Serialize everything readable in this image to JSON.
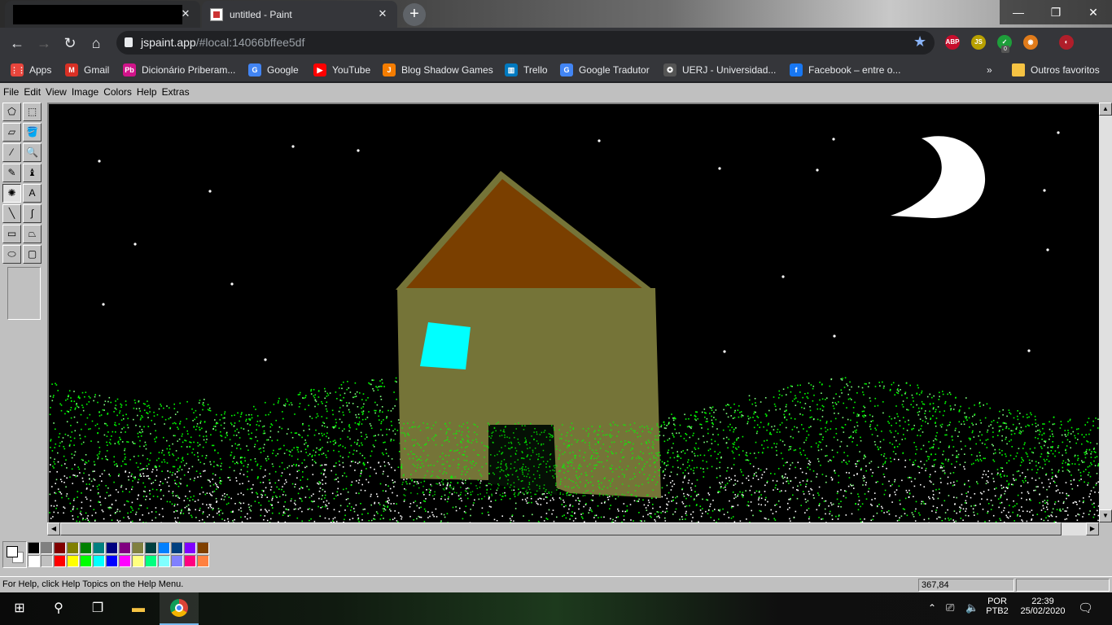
{
  "browser": {
    "tabs": [
      {
        "title": "",
        "redacted": true
      },
      {
        "title": "untitled - Paint"
      }
    ],
    "new_tab_label": "+",
    "window_controls": {
      "minimize": "—",
      "restore": "❐",
      "close": "✕"
    },
    "address": {
      "host": "jspaint.app",
      "path": "/#local:14066bffee5df"
    },
    "nav_icons": [
      "back-icon",
      "forward-icon",
      "reload-icon",
      "home-icon"
    ],
    "extensions": [
      {
        "name": "adblock-plus-icon",
        "label": "ABP",
        "color": "#c70d2c"
      },
      {
        "name": "js-icon",
        "label": "JS",
        "color": "#b8a000"
      },
      {
        "name": "shield-check-icon",
        "label": "✓",
        "color": "#1e9e3a",
        "badge": "0"
      },
      {
        "name": "owl-icon",
        "label": "◉",
        "color": "#e07b1a"
      },
      {
        "name": "profile-avatar-icon",
        "label": "◐",
        "color": "#b01e2a"
      }
    ],
    "bookmarks": [
      {
        "label": "Apps",
        "icon": "apps-grid-icon",
        "color": "#e8453c"
      },
      {
        "label": "Gmail",
        "icon": "gmail-icon",
        "color": "#d93025"
      },
      {
        "label": "Dicionário Priberam...",
        "icon": "priberam-icon",
        "color": "#d1148a"
      },
      {
        "label": "Google",
        "icon": "google-icon",
        "color": "#4285f4"
      },
      {
        "label": "YouTube",
        "icon": "youtube-icon",
        "color": "#ff0000"
      },
      {
        "label": "Blog Shadow Games",
        "icon": "blogger-icon",
        "color": "#f57d00"
      },
      {
        "label": "Trello",
        "icon": "trello-icon",
        "color": "#0079bf"
      },
      {
        "label": "Google Tradutor",
        "icon": "google-translate-icon",
        "color": "#4285f4"
      },
      {
        "label": "UERJ - Universidad...",
        "icon": "uerj-icon",
        "color": "#555555"
      },
      {
        "label": "Facebook – entre o...",
        "icon": "facebook-icon",
        "color": "#1877f2"
      }
    ],
    "bookmarks_overflow": "»",
    "other_bookmarks": "Outros favoritos"
  },
  "paint": {
    "menus": [
      "File",
      "Edit",
      "View",
      "Image",
      "Colors",
      "Help",
      "Extras"
    ],
    "tools": [
      {
        "name": "free-form-select-tool",
        "glyph": "⬠"
      },
      {
        "name": "rectangle-select-tool",
        "glyph": "⬚"
      },
      {
        "name": "eraser-tool",
        "glyph": "▱"
      },
      {
        "name": "fill-bucket-tool",
        "glyph": "🪣"
      },
      {
        "name": "color-picker-tool",
        "glyph": "⁄"
      },
      {
        "name": "magnifier-tool",
        "glyph": "🔍"
      },
      {
        "name": "pencil-tool",
        "glyph": "✎"
      },
      {
        "name": "brush-tool",
        "glyph": "♝"
      },
      {
        "name": "airbrush-tool",
        "glyph": "✺"
      },
      {
        "name": "text-tool",
        "glyph": "A"
      },
      {
        "name": "line-tool",
        "glyph": "╲"
      },
      {
        "name": "curve-tool",
        "glyph": "∫"
      },
      {
        "name": "rectangle-tool",
        "glyph": "▭"
      },
      {
        "name": "polygon-tool",
        "glyph": "⏢"
      },
      {
        "name": "ellipse-tool",
        "glyph": "⬭"
      },
      {
        "name": "rounded-rectangle-tool",
        "glyph": "▢"
      }
    ],
    "active_tool": "airbrush-tool",
    "palette_top": [
      "#000000",
      "#808080",
      "#800000",
      "#808000",
      "#008000",
      "#008080",
      "#000080",
      "#800080",
      "#808040",
      "#004040",
      "#0080ff",
      "#004080",
      "#8000ff",
      "#804000"
    ],
    "palette_bottom": [
      "#ffffff",
      "#c0c0c0",
      "#ff0000",
      "#ffff00",
      "#00ff00",
      "#00ffff",
      "#0000ff",
      "#ff00ff",
      "#ffff80",
      "#00ff80",
      "#80ffff",
      "#8080ff",
      "#ff0080",
      "#ff8040"
    ],
    "foreground_color": "#ffffff",
    "background_color": "#ffffff",
    "drawing": {
      "sky_color": "#000000",
      "roof_color": "#7a3f00",
      "wall_color": "#757438",
      "window_color": "#00ffff",
      "moon_color": "#ffffff",
      "grass_colors": [
        "#00ff00",
        "#ffffff",
        "#80ff80"
      ]
    },
    "status_help": "For Help, click Help Topics on the Help Menu.",
    "status_coords": "367,84"
  },
  "taskbar": {
    "apps": [
      "windows-start-icon",
      "search-icon",
      "task-view-icon",
      "file-explorer-icon",
      "chrome-icon"
    ],
    "tray": {
      "language": "POR",
      "layout": "PTB2",
      "time": "22:39",
      "date": "25/02/2020"
    }
  }
}
